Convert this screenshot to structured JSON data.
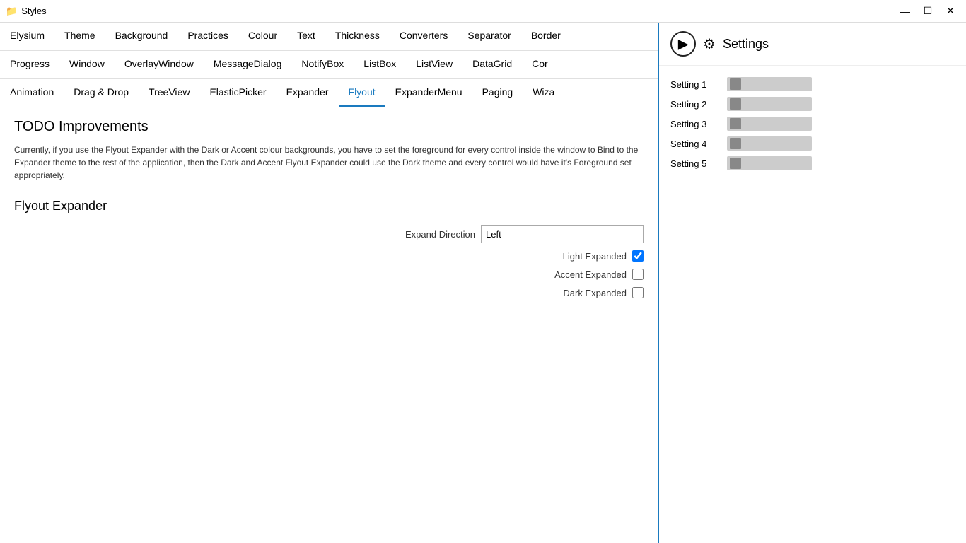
{
  "titleBar": {
    "icon": "📁",
    "title": "Styles",
    "minimize": "—",
    "maximize": "☐",
    "close": "✕"
  },
  "nav1": {
    "items": [
      "Elysium",
      "Theme",
      "Background",
      "Practices",
      "Colour",
      "Text",
      "Thickness",
      "Converters",
      "Separator",
      "Border"
    ]
  },
  "nav2": {
    "items": [
      "Progress",
      "Window",
      "OverlayWindow",
      "MessageDialog",
      "NotifyBox",
      "ListBox",
      "ListView",
      "DataGrid",
      "Cor"
    ]
  },
  "nav3": {
    "items": [
      "Animation",
      "Drag & Drop",
      "TreeView",
      "ElasticPicker",
      "Expander",
      "Flyout",
      "ExpanderMenu",
      "Paging",
      "Wiza"
    ]
  },
  "content": {
    "heading": "TODO Improvements",
    "description": "Currently, if you use the Flyout Expander with the Dark or Accent colour backgrounds, you have to set the foreground for every control inside the window to Bind to the Expander theme to the rest of the application, then the Dark and Accent Flyout Expander could use the Dark theme and every control would have it's Foreground set appropriately.",
    "sectionTitle": "Flyout Expander",
    "expandDirectionLabel": "Expand Direction",
    "expandDirectionValue": "Left",
    "lightExpandedLabel": "Light Expanded",
    "lightExpandedChecked": true,
    "accentExpandedLabel": "Accent Expanded",
    "accentExpandedChecked": false,
    "darkExpandedLabel": "Dark Expanded",
    "darkExpandedChecked": false
  },
  "rightPanel": {
    "title": "Settings",
    "settings": [
      {
        "label": "Setting 1"
      },
      {
        "label": "Setting 2"
      },
      {
        "label": "Setting 3"
      },
      {
        "label": "Setting 4"
      },
      {
        "label": "Setting 5"
      }
    ]
  }
}
